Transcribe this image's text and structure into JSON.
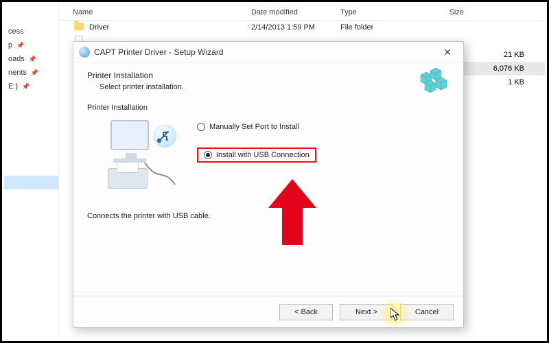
{
  "explorer": {
    "columns": {
      "name": "Name",
      "date": "Date modified",
      "type": "Type",
      "size": "Size"
    },
    "sidebar": [
      "cess",
      "p",
      "oads",
      "nents",
      "E:)"
    ],
    "rows": [
      {
        "name": "Driver",
        "date": "2/14/2013 1:59 PM",
        "type": "File folder",
        "size": ""
      }
    ],
    "sizes_peek": [
      "21 KB",
      "6,076 KB",
      "1 KB"
    ]
  },
  "dialog": {
    "title": "CAPT Printer Driver - Setup Wizard",
    "heading": "Printer Installation",
    "subheading": "Select printer installation.",
    "group": "Printer Installation",
    "option_manual": "Manually Set Port to Install",
    "option_usb": "Install with USB Connection",
    "description": "Connects the printer with USB cable.",
    "buttons": {
      "back": "< Back",
      "next": "Next >",
      "cancel": "Cancel"
    },
    "selected_option": "usb"
  }
}
